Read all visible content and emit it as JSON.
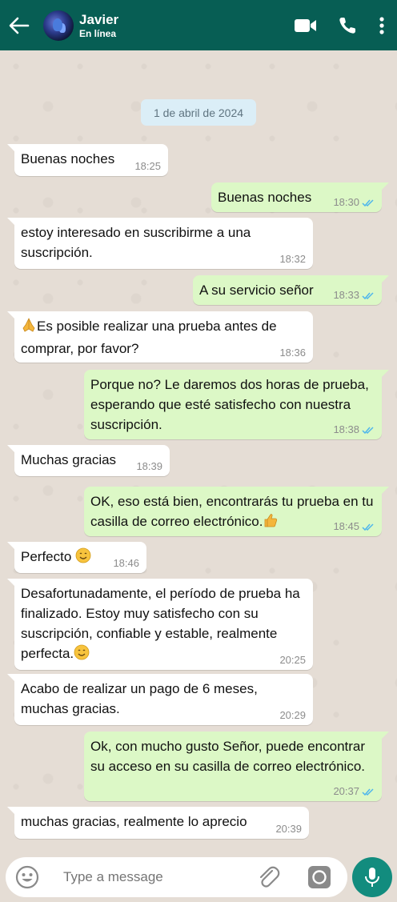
{
  "header": {
    "contact_name": "Javier",
    "status": "En línea"
  },
  "chat": {
    "date_chip": "1 de abril de 2024",
    "messages": [
      {
        "dir": "in",
        "text": "Buenas noches",
        "time": "18:25"
      },
      {
        "dir": "out",
        "text": "Buenas noches",
        "time": "18:30",
        "read": true
      },
      {
        "dir": "in",
        "text": "estoy interesado en suscribirme a una suscripción.",
        "time": "18:32"
      },
      {
        "dir": "out",
        "text": "A su servicio señor",
        "time": "18:33",
        "read": true
      },
      {
        "dir": "in",
        "text": "Es posible realizar una prueba antes de comprar, por favor?",
        "time": "18:36",
        "emoji": "folded-hands"
      },
      {
        "dir": "out",
        "text": "Porque no? Le daremos dos horas de prueba, esperando que esté satisfecho con nuestra suscripción.",
        "time": "18:38",
        "read": true
      },
      {
        "dir": "in",
        "text": "Muchas gracias",
        "time": "18:39"
      },
      {
        "dir": "out",
        "text": "OK, eso está bien, encontrarás tu prueba en tu casilla de correo electrónico.",
        "time": "18:45",
        "read": true,
        "emoji": "thumbs-up"
      },
      {
        "dir": "in",
        "text": "Perfecto",
        "time": "18:46",
        "emoji": "smiling-face"
      },
      {
        "dir": "in",
        "text": "Desafortunadamente, el período de prueba ha finalizado. Estoy muy satisfecho con su suscripción, confiable y estable, realmente perfecta.",
        "time": "20:25",
        "emoji": "smiling-face"
      },
      {
        "dir": "in",
        "text": "Acabo de realizar un pago de 6 meses, muchas gracias.",
        "time": "20:29"
      },
      {
        "dir": "out",
        "text": "Ok, con mucho gusto Señor, puede encontrar su acceso en su casilla de correo electrónico.",
        "time": "20:37",
        "read": true
      },
      {
        "dir": "in",
        "text": "muchas gracias, realmente lo aprecio",
        "time": "20:39"
      }
    ]
  },
  "input": {
    "placeholder": "Type a message"
  },
  "colors": {
    "header": "#075e54",
    "outgoing_bubble": "#dcf8c6",
    "incoming_bubble": "#ffffff",
    "read_ticks": "#4fb6ec",
    "mic_button": "#128c7e"
  },
  "icons": [
    "back-arrow-icon",
    "video-call-icon",
    "phone-icon",
    "more-vert-icon",
    "emoji-icon",
    "paperclip-icon",
    "camera-icon",
    "microphone-icon"
  ]
}
